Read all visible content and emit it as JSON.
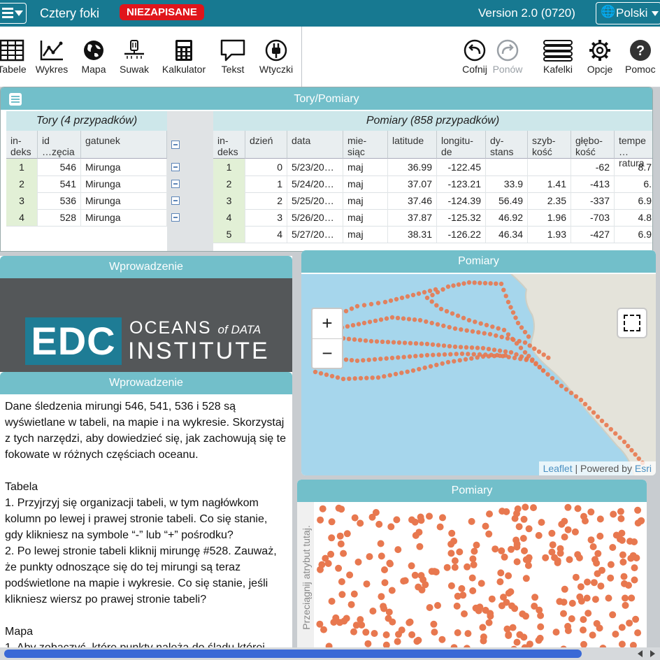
{
  "menubar": {
    "title": "Cztery foki",
    "unsaved": "NIEZAPISANE",
    "version": "Version 2.0 (0720)",
    "language": "Polski"
  },
  "tools": {
    "left": [
      "Tabele",
      "Wykres",
      "Mapa",
      "Suwak",
      "Kalkulator",
      "Tekst",
      "Wtyczki"
    ],
    "right": [
      {
        "label": "Cofnij",
        "enabled": true
      },
      {
        "label": "Ponów",
        "enabled": false
      },
      {
        "label": "Kafelki",
        "enabled": true
      },
      {
        "label": "Opcje",
        "enabled": true
      },
      {
        "label": "Pomoc",
        "enabled": true
      }
    ]
  },
  "case_table": {
    "title": "Tory/Pomiary",
    "left": {
      "collection": "Tory (4 przypadków)",
      "headers": [
        "in-\ndeks",
        "id\n…zęcia",
        "gatunek"
      ],
      "rows": [
        [
          "1",
          "546",
          "Mirunga"
        ],
        [
          "2",
          "541",
          "Mirunga"
        ],
        [
          "3",
          "536",
          "Mirunga"
        ],
        [
          "4",
          "528",
          "Mirunga"
        ]
      ]
    },
    "right": {
      "collection": "Pomiary (858 przypadków)",
      "headers": [
        "in-\ndeks",
        "dzień",
        "data",
        "mie-\nsiąc",
        "latitude",
        "longitu-\nde",
        "dy-\nstans",
        "szyb-\nkość",
        "głębo-\nkość",
        "tempe\n…ratura"
      ],
      "rows": [
        [
          "1",
          "0",
          "5/23/20…",
          "maj",
          "36.99",
          "-122.45",
          "",
          "",
          "-62",
          "8.7"
        ],
        [
          "2",
          "1",
          "5/24/20…",
          "maj",
          "37.07",
          "-123.21",
          "33.9",
          "1.41",
          "-413",
          "6."
        ],
        [
          "3",
          "2",
          "5/25/20…",
          "maj",
          "37.46",
          "-124.39",
          "56.49",
          "2.35",
          "-337",
          "6.9"
        ],
        [
          "4",
          "3",
          "5/26/20…",
          "maj",
          "37.87",
          "-125.32",
          "46.92",
          "1.96",
          "-703",
          "4.8"
        ],
        [
          "5",
          "4",
          "5/27/20…",
          "maj",
          "38.31",
          "-126.22",
          "46.34",
          "1.93",
          "-427",
          "6.9"
        ]
      ]
    }
  },
  "text_tile": {
    "logo_title": "Wprowadzenie",
    "logo": {
      "mark": "EDC",
      "line1a": "OCEANS",
      "line1b": "of DATA",
      "line2": "INSTITUTE"
    },
    "title": "Wprowadzenie",
    "paragraphs": [
      "Dane śledzenia mirungi 546, 541, 536 i 528 są wyświetlane w tabeli, na mapie i na wykresie. Skorzystaj z tych narzędzi, aby dowiedzieć się, jak zachowują się te fokowate w różnych częściach oceanu.",
      "",
      "Tabela",
      "1. Przyjrzyj się organizacji tabeli, w tym nagłówkom kolumn po lewej i prawej stronie tabeli. Co się stanie, gdy klikniesz na symbole “-” lub “+” pośrodku?",
      "2. Po lewej stronie tabeli kliknij mirungę #528. Zauważ, że punkty odnoszące się do tej mirungi są teraz podświetlone na mapie i wykresie. Co się stanie, jeśli klikniesz wiersz po prawej stronie tabeli?",
      "",
      "Mapa",
      "1. Aby zobaczyć, które punkty należą do śladu której"
    ]
  },
  "map_tile": {
    "title": "Pomiary",
    "zoom_in": "+",
    "zoom_out": "−",
    "attribution_link": "Leaflet",
    "attribution_sep": " | Powered by ",
    "attribution_src": "Esri"
  },
  "graph_tile": {
    "title": "Pomiary",
    "y_placeholder": "Przeciągnij atrybut tutaj."
  },
  "colors": {
    "header": "#177991",
    "tile_title": "#72bfca",
    "point": "#e8784f",
    "badge": "#e0151b"
  }
}
